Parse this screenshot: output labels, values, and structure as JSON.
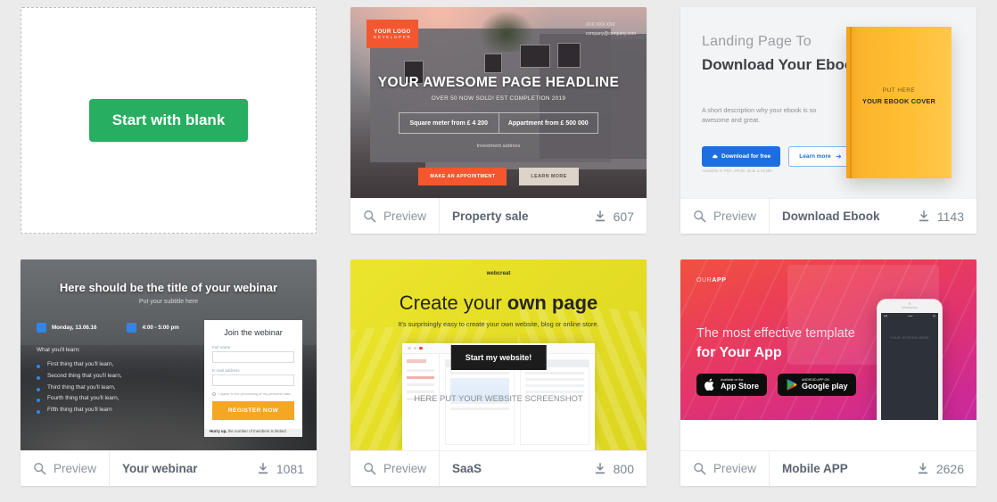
{
  "blank_card": {
    "button_label": "Start with blank"
  },
  "footer_labels": {
    "preview": "Preview"
  },
  "templates": [
    {
      "name": "property-sale",
      "title": "Property sale",
      "downloads": "607",
      "preview": "Preview",
      "thumb": {
        "logo_title": "YOUR LOGO",
        "logo_sub": "DEVELOPER",
        "contact_phone": "XXX XXX XXX",
        "contact_email": "company@company.com",
        "headline": "YOUR AWESOME PAGE HEADLINE",
        "subheadline": "OVER 50 NOW SOLD! EST COMPLETION 2019",
        "box_left": "Square meter from £ 4 200",
        "box_right": "Appartment from £ 500 000",
        "address": "Investment address",
        "button_primary": "MAKE AN APPOINTMENT",
        "button_secondary": "LEARN MORE"
      }
    },
    {
      "name": "download-ebook",
      "title": "Download Ebook",
      "downloads": "1143",
      "preview": "Preview",
      "thumb": {
        "heading_light": "Landing Page To",
        "heading_bold": "Download Your Ebook",
        "description": "A short description why your ebook is so awesome and great.",
        "button_primary": "Download for free",
        "button_secondary": "Learn more",
        "availability": "Available in PDF, ePUB, Mobi & Kindle",
        "book_line1": "PUT HERE",
        "book_line2": "YOUR EBOOK COVER"
      }
    },
    {
      "name": "your-webinar",
      "title": "Your webinar",
      "downloads": "1081",
      "preview": "Preview",
      "thumb": {
        "title": "Here should be the title of your webinar",
        "subtitle": "Put your subtitle here",
        "date": "Monday, 13.06.16",
        "time": "4:00 - 5:00 pm",
        "learn_heading": "What you'll learn:",
        "learn_items": [
          "First thing that you'll learn,",
          "Second thing that you'll learn,",
          "Third thing that you'll learn,",
          "Fourth thing that you'll learn,",
          "Fifth thing that you'll learn"
        ],
        "form_title": "Join the webinar",
        "form_label_name": "Full name",
        "form_label_email": "E-mail address",
        "form_consent": "I agree to the processing of my personal data...",
        "form_button": "REGISTER NOW",
        "hurry_bold": "Hurry up,",
        "hurry_rest": " the number of members is limited"
      }
    },
    {
      "name": "saas",
      "title": "SaaS",
      "downloads": "800",
      "preview": "Preview",
      "thumb": {
        "brand": "webcreat",
        "heading_light": "Create your ",
        "heading_bold": "own page",
        "subheading": "It's surprisingly easy to create your own website, blog or online store.",
        "screenshot_label": "HERE PUT YOUR WEBSITE SCREENSHOT",
        "cta": "Start my website!"
      }
    },
    {
      "name": "mobile-app",
      "title": "Mobile APP",
      "downloads": "2626",
      "preview": "Preview",
      "thumb": {
        "logo_light": "OUR",
        "logo_bold": "APP",
        "heading_light": "The most effective template",
        "heading_bold": "for Your App",
        "appstore_small": "Available on the",
        "appstore_big": "App Store",
        "googleplay_small": "ANDROID APP ON",
        "googleplay_big": "Google play",
        "phone_screen_label": "YOUR SCREEN HERE"
      }
    }
  ],
  "colors": {
    "page_background": "#ebebeb",
    "accent_green": "#27ae60",
    "footer_text": "#5a6472",
    "preview_text": "#8b95a0"
  }
}
